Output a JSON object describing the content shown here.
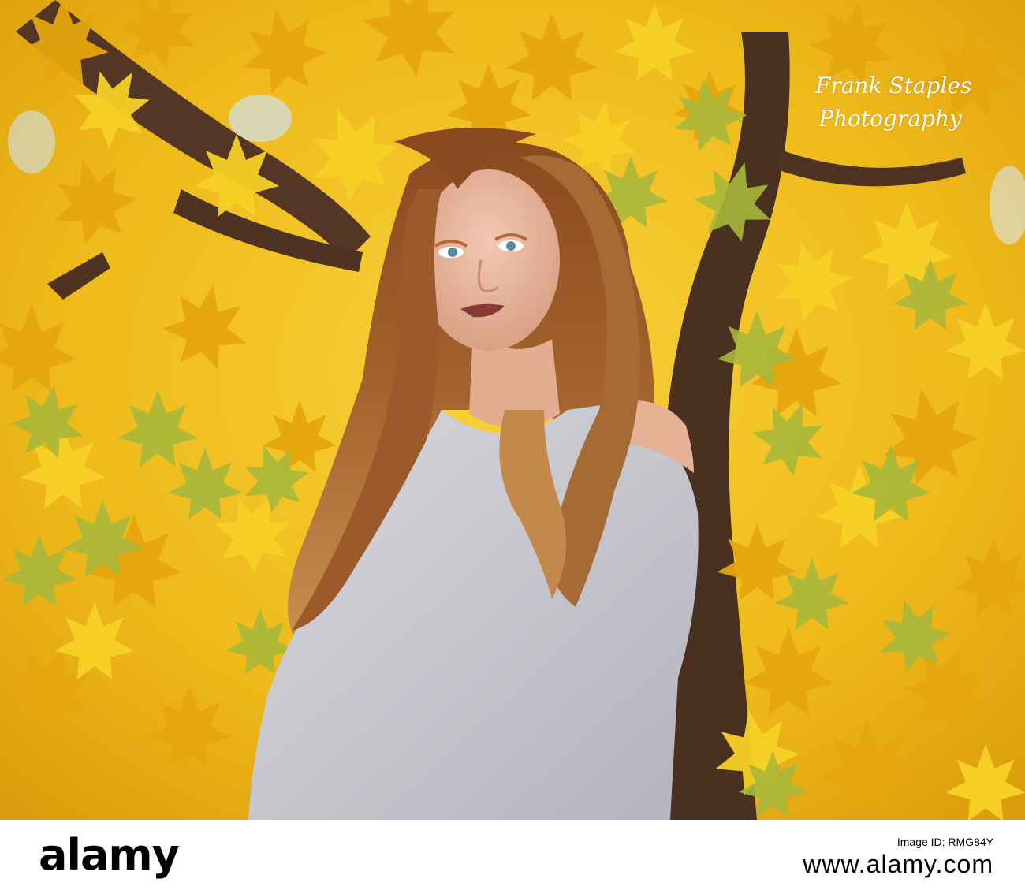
{
  "photo": {
    "alt": "Young woman with long curly auburn hair wearing a gray knit sweater standing beneath a tree with yellow autumn leaves",
    "watermark": {
      "line1": "Frank Staples",
      "line2": "Photography"
    }
  },
  "footer": {
    "logo": "alamy",
    "image_id_label": "Image ID:",
    "image_id": "RMG84Y",
    "url": "www.alamy.com"
  },
  "colors": {
    "leaf_yellow": "#f2c318",
    "leaf_gold": "#e6a60e",
    "leaf_green": "#a9b83a",
    "bark": "#4a3020",
    "hair": "#9a5a2a",
    "sweater": "#c9c8cf",
    "skin": "#e8b9a0"
  }
}
